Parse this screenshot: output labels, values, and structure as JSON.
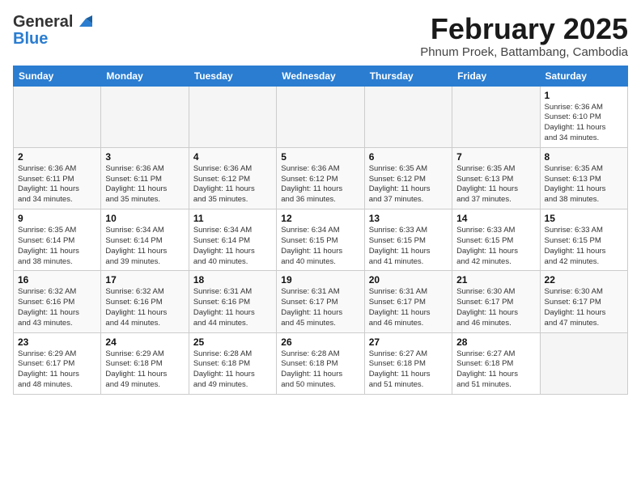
{
  "header": {
    "logo_general": "General",
    "logo_blue": "Blue",
    "month_title": "February 2025",
    "location": "Phnum Proek, Battambang, Cambodia"
  },
  "days_of_week": [
    "Sunday",
    "Monday",
    "Tuesday",
    "Wednesday",
    "Thursday",
    "Friday",
    "Saturday"
  ],
  "weeks": [
    [
      {
        "day": "",
        "text": ""
      },
      {
        "day": "",
        "text": ""
      },
      {
        "day": "",
        "text": ""
      },
      {
        "day": "",
        "text": ""
      },
      {
        "day": "",
        "text": ""
      },
      {
        "day": "",
        "text": ""
      },
      {
        "day": "1",
        "text": "Sunrise: 6:36 AM\nSunset: 6:10 PM\nDaylight: 11 hours\nand 34 minutes."
      }
    ],
    [
      {
        "day": "2",
        "text": "Sunrise: 6:36 AM\nSunset: 6:11 PM\nDaylight: 11 hours\nand 34 minutes."
      },
      {
        "day": "3",
        "text": "Sunrise: 6:36 AM\nSunset: 6:11 PM\nDaylight: 11 hours\nand 35 minutes."
      },
      {
        "day": "4",
        "text": "Sunrise: 6:36 AM\nSunset: 6:12 PM\nDaylight: 11 hours\nand 35 minutes."
      },
      {
        "day": "5",
        "text": "Sunrise: 6:36 AM\nSunset: 6:12 PM\nDaylight: 11 hours\nand 36 minutes."
      },
      {
        "day": "6",
        "text": "Sunrise: 6:35 AM\nSunset: 6:12 PM\nDaylight: 11 hours\nand 37 minutes."
      },
      {
        "day": "7",
        "text": "Sunrise: 6:35 AM\nSunset: 6:13 PM\nDaylight: 11 hours\nand 37 minutes."
      },
      {
        "day": "8",
        "text": "Sunrise: 6:35 AM\nSunset: 6:13 PM\nDaylight: 11 hours\nand 38 minutes."
      }
    ],
    [
      {
        "day": "9",
        "text": "Sunrise: 6:35 AM\nSunset: 6:14 PM\nDaylight: 11 hours\nand 38 minutes."
      },
      {
        "day": "10",
        "text": "Sunrise: 6:34 AM\nSunset: 6:14 PM\nDaylight: 11 hours\nand 39 minutes."
      },
      {
        "day": "11",
        "text": "Sunrise: 6:34 AM\nSunset: 6:14 PM\nDaylight: 11 hours\nand 40 minutes."
      },
      {
        "day": "12",
        "text": "Sunrise: 6:34 AM\nSunset: 6:15 PM\nDaylight: 11 hours\nand 40 minutes."
      },
      {
        "day": "13",
        "text": "Sunrise: 6:33 AM\nSunset: 6:15 PM\nDaylight: 11 hours\nand 41 minutes."
      },
      {
        "day": "14",
        "text": "Sunrise: 6:33 AM\nSunset: 6:15 PM\nDaylight: 11 hours\nand 42 minutes."
      },
      {
        "day": "15",
        "text": "Sunrise: 6:33 AM\nSunset: 6:15 PM\nDaylight: 11 hours\nand 42 minutes."
      }
    ],
    [
      {
        "day": "16",
        "text": "Sunrise: 6:32 AM\nSunset: 6:16 PM\nDaylight: 11 hours\nand 43 minutes."
      },
      {
        "day": "17",
        "text": "Sunrise: 6:32 AM\nSunset: 6:16 PM\nDaylight: 11 hours\nand 44 minutes."
      },
      {
        "day": "18",
        "text": "Sunrise: 6:31 AM\nSunset: 6:16 PM\nDaylight: 11 hours\nand 44 minutes."
      },
      {
        "day": "19",
        "text": "Sunrise: 6:31 AM\nSunset: 6:17 PM\nDaylight: 11 hours\nand 45 minutes."
      },
      {
        "day": "20",
        "text": "Sunrise: 6:31 AM\nSunset: 6:17 PM\nDaylight: 11 hours\nand 46 minutes."
      },
      {
        "day": "21",
        "text": "Sunrise: 6:30 AM\nSunset: 6:17 PM\nDaylight: 11 hours\nand 46 minutes."
      },
      {
        "day": "22",
        "text": "Sunrise: 6:30 AM\nSunset: 6:17 PM\nDaylight: 11 hours\nand 47 minutes."
      }
    ],
    [
      {
        "day": "23",
        "text": "Sunrise: 6:29 AM\nSunset: 6:17 PM\nDaylight: 11 hours\nand 48 minutes."
      },
      {
        "day": "24",
        "text": "Sunrise: 6:29 AM\nSunset: 6:18 PM\nDaylight: 11 hours\nand 49 minutes."
      },
      {
        "day": "25",
        "text": "Sunrise: 6:28 AM\nSunset: 6:18 PM\nDaylight: 11 hours\nand 49 minutes."
      },
      {
        "day": "26",
        "text": "Sunrise: 6:28 AM\nSunset: 6:18 PM\nDaylight: 11 hours\nand 50 minutes."
      },
      {
        "day": "27",
        "text": "Sunrise: 6:27 AM\nSunset: 6:18 PM\nDaylight: 11 hours\nand 51 minutes."
      },
      {
        "day": "28",
        "text": "Sunrise: 6:27 AM\nSunset: 6:18 PM\nDaylight: 11 hours\nand 51 minutes."
      },
      {
        "day": "",
        "text": ""
      }
    ]
  ]
}
